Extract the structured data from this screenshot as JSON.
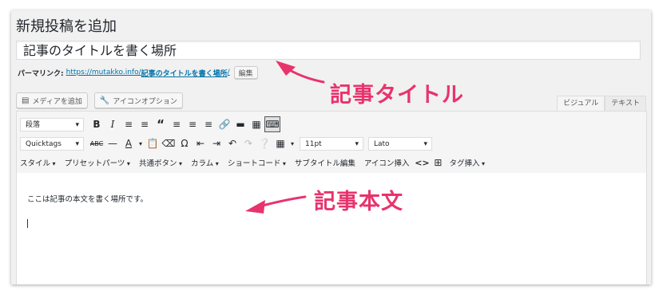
{
  "page_title": "新規投稿を追加",
  "title_value": "記事のタイトルを書く場所",
  "permalink": {
    "label": "パーマリンク:",
    "base": "https://mutakko.info/",
    "slug": "記事のタイトルを書く場所",
    "trail": "/",
    "edit": "編集"
  },
  "media": {
    "add_media": "メディアを追加",
    "icon_option": "アイコンオプション"
  },
  "tabs": {
    "visual": "ビジュアル",
    "text": "テキスト"
  },
  "toolbar": {
    "format_select": "段落",
    "quicktags_select": "Quicktags",
    "size_select": "11pt",
    "font_select": "Lato",
    "menus": [
      "スタイル",
      "プリセットパーツ",
      "共通ボタン",
      "カラム",
      "ショートコード"
    ],
    "plain_menus": [
      "サブタイトル編集",
      "アイコン挿入"
    ],
    "last_menu": "タグ挿入"
  },
  "content": "ここは記事の本文を書く場所です。",
  "annotations": {
    "title": "記事タイトル",
    "body": "記事本文"
  },
  "colors": {
    "accent": "#e8336d",
    "link": "#0073aa",
    "frame_bg": "#f1f1f1"
  }
}
